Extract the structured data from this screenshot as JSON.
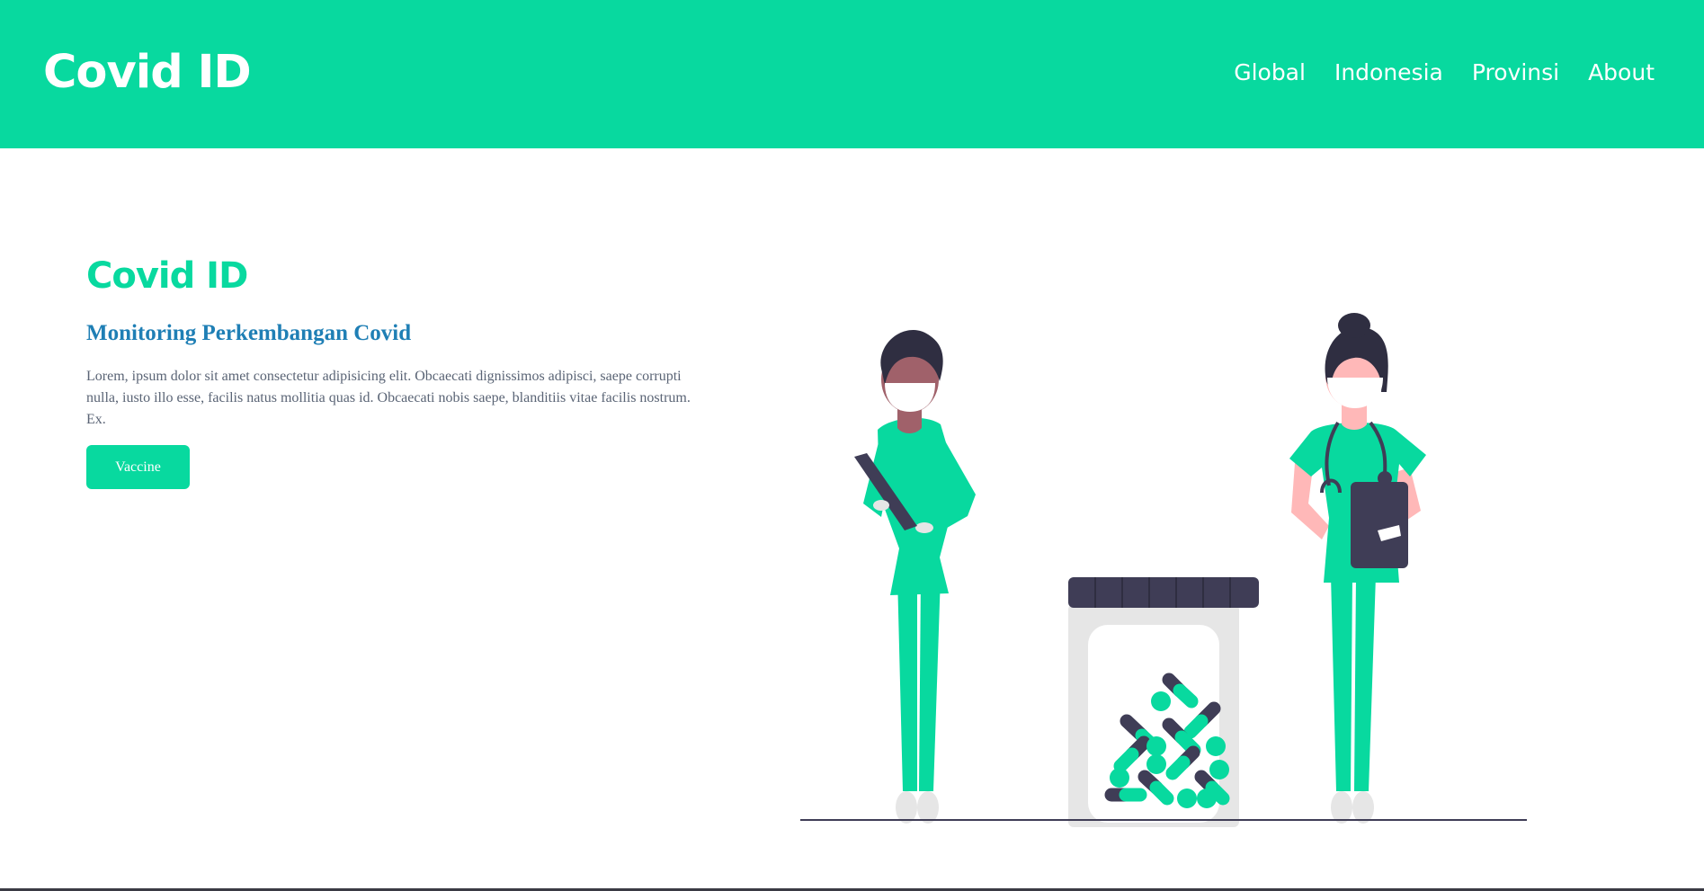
{
  "navbar": {
    "brand": "Covid ID",
    "links": [
      "Global",
      "Indonesia",
      "Provinsi",
      "About"
    ]
  },
  "hero": {
    "title": "Covid ID",
    "subtitle": "Monitoring Perkembangan Covid",
    "text": "Lorem, ipsum dolor sit amet consectetur adipisicing elit. Obcaecati dignissimos adipisci, saepe corrupti nulla, iusto illo esse, facilis natus mollitia quas id. Obcaecati nobis saepe, blanditiis vitae facilis nostrum. Ex.",
    "button_label": "Vaccine"
  },
  "colors": {
    "accent": "#08d99f",
    "subtitle": "#1f7fb5",
    "dark": "#3f3d56"
  },
  "illustration": {
    "icon": "medical-staff-with-pill-jar-illustration"
  }
}
